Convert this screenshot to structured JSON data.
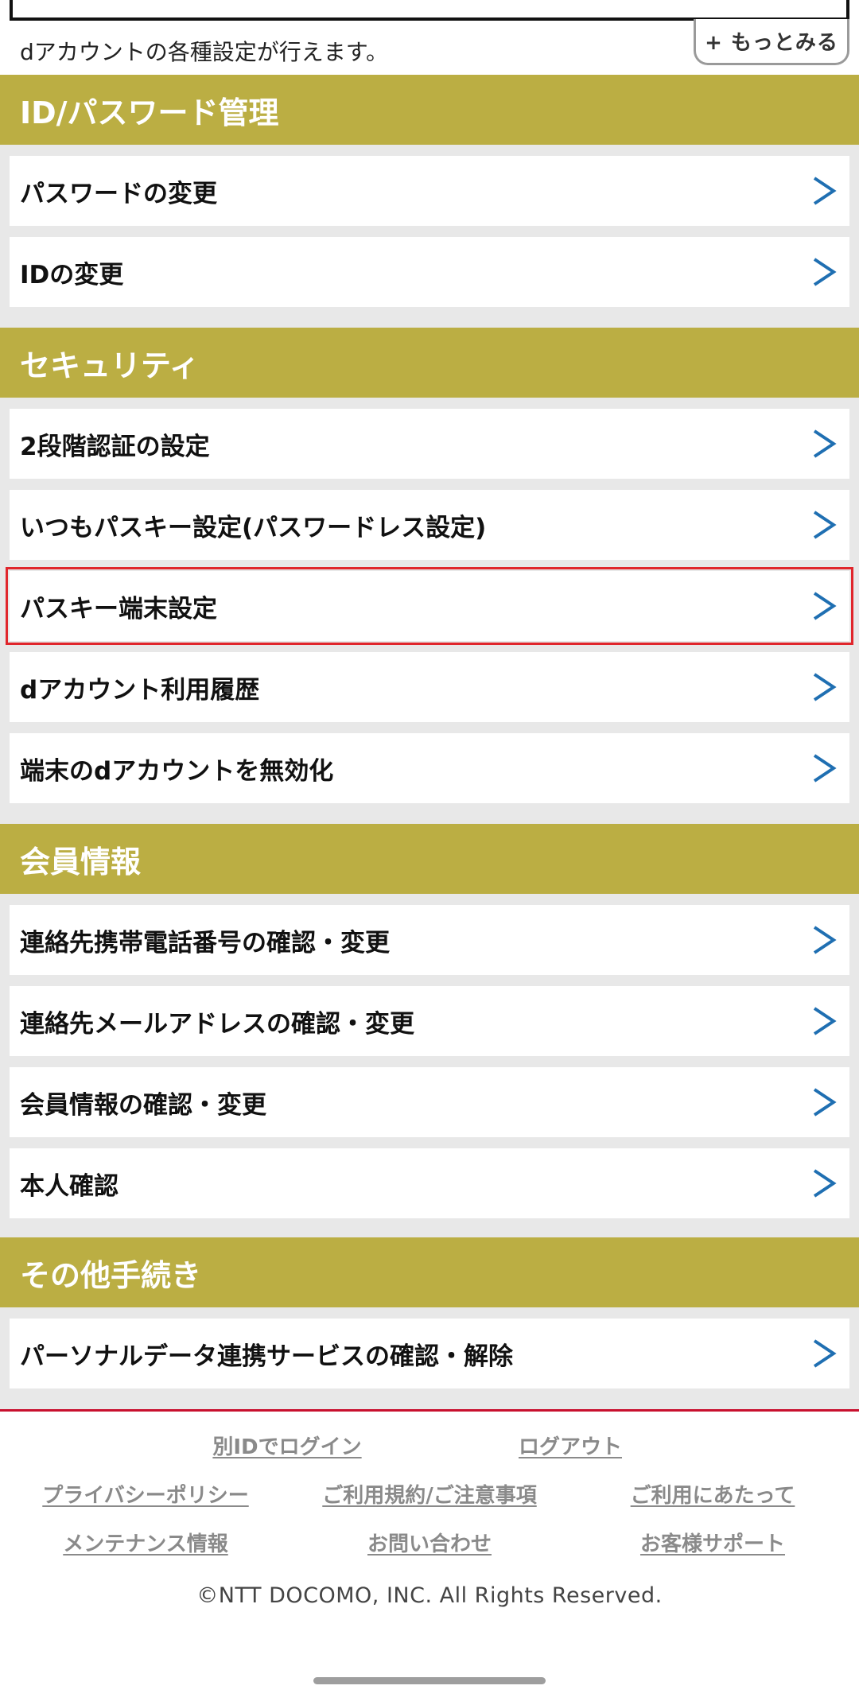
{
  "intro": {
    "text": "dアカウントの各種設定が行えます。",
    "more_label": "+ もっとみる"
  },
  "sections": [
    {
      "title": "ID/パスワード管理",
      "items": [
        "パスワードの変更",
        "IDの変更"
      ]
    },
    {
      "title": "セキュリティ",
      "items": [
        "2段階認証の設定",
        "いつもパスキー設定(パスワードレス設定)",
        "パスキー端末設定",
        "dアカウント利用履歴",
        "端末のdアカウントを無効化"
      ]
    },
    {
      "title": "会員情報",
      "items": [
        "連絡先携帯電話番号の確認・変更",
        "連絡先メールアドレスの確認・変更",
        "会員情報の確認・変更",
        "本人確認"
      ]
    },
    {
      "title": "その他手続き",
      "items": [
        "パーソナルデータ連携サービスの確認・解除"
      ]
    }
  ],
  "footer": {
    "links": {
      "login_other": "別IDでログイン",
      "logout": "ログアウト",
      "privacy": "プライバシーポリシー",
      "terms": "ご利用規約/ご注意事項",
      "usage": "ご利用にあたって",
      "maintenance": "メンテナンス情報",
      "contact": "お問い合わせ",
      "support": "お客様サポート"
    },
    "copyright": "©NTT DOCOMO, INC. All Rights Reserved."
  },
  "colors": {
    "section_header": "#bbae43",
    "chevron": "#1f6fb2",
    "highlight": "#e0262c",
    "footer_rule": "#c8102e"
  },
  "icons": {
    "item_chevron": "chevron-right-icon"
  }
}
